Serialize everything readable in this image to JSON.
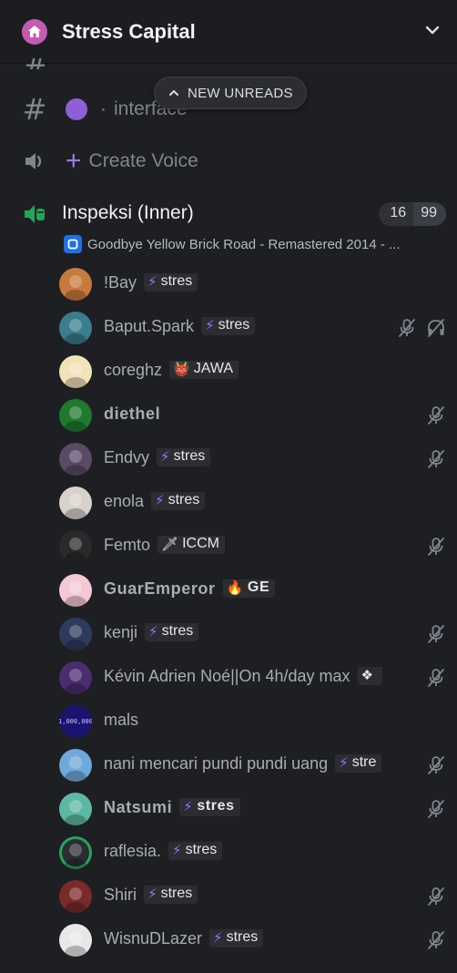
{
  "server": {
    "name": "Stress Capital",
    "icon": "home-icon",
    "accent": "#c45bb1"
  },
  "unreads_pill": {
    "label": "NEW UNREADS",
    "icon": "chevron-up-icon"
  },
  "channels": [
    {
      "type": "text",
      "icon": "hash-icon",
      "prefix_icon": "purple-circle",
      "separator": "·",
      "name": "interface"
    },
    {
      "type": "voice",
      "icon": "speaker-icon",
      "prefix_icon": "plus-icon",
      "name": "Create Voice"
    }
  ],
  "voice_channel": {
    "name": "Inspeksi (Inner)",
    "icon": "voice-connected-icon",
    "count_current": "16",
    "count_limit": "99",
    "activity": "Goodbye Yellow Brick Road - Remastered 2014 - ..."
  },
  "members": [
    {
      "name": "!Bay",
      "tag_glyph": "⚡",
      "tag": "stres",
      "bold": false,
      "muted": false,
      "deafened": false,
      "avatar_bg": "#c77a3d"
    },
    {
      "name": "Baput.Spark",
      "tag_glyph": "⚡",
      "tag": "stres",
      "bold": false,
      "muted": true,
      "deafened": true,
      "avatar_bg": "#3a7d8c"
    },
    {
      "name": "coreghz",
      "tag_glyph": "👹",
      "tag": "JAWA",
      "bold": false,
      "muted": false,
      "deafened": false,
      "avatar_bg": "#f2e2b8"
    },
    {
      "name": "diethel",
      "tag_glyph": "",
      "tag": "",
      "bold": true,
      "muted": true,
      "deafened": false,
      "avatar_bg": "#1f7a2e"
    },
    {
      "name": "Endvy",
      "tag_glyph": "⚡",
      "tag": "stres",
      "bold": false,
      "muted": true,
      "deafened": false,
      "avatar_bg": "#5a4a66"
    },
    {
      "name": "enola",
      "tag_glyph": "⚡",
      "tag": "stres",
      "bold": false,
      "muted": false,
      "deafened": false,
      "avatar_bg": "#d8d2cc"
    },
    {
      "name": "Femto",
      "tag_glyph": "🗡",
      "tag": "ICCM",
      "bold": false,
      "muted": true,
      "deafened": false,
      "avatar_bg": "#2a2a2a"
    },
    {
      "name": "GuarEmperor",
      "tag_glyph": "🔥",
      "tag": "GE",
      "bold": true,
      "muted": false,
      "deafened": false,
      "avatar_bg": "#f4c9d6"
    },
    {
      "name": "kenji",
      "tag_glyph": "⚡",
      "tag": "stres",
      "bold": false,
      "muted": true,
      "deafened": false,
      "avatar_bg": "#2c3a5c"
    },
    {
      "name": "Kévin Adrien Noé||On 4h/day max",
      "tag_glyph": "❖",
      "tag": "",
      "bold": false,
      "muted": true,
      "deafened": false,
      "avatar_bg": "#4a2d6e"
    },
    {
      "name": "mals",
      "tag_glyph": "",
      "tag": "",
      "bold": false,
      "muted": false,
      "deafened": false,
      "avatar_bg": "#1a1470",
      "avatar_text": "1,000,000"
    },
    {
      "name": "nani mencari pundi pundi uang",
      "tag_glyph": "⚡",
      "tag": "stre",
      "bold": false,
      "muted": true,
      "deafened": false,
      "avatar_bg": "#6fa8d9"
    },
    {
      "name": "Natsumi",
      "tag_glyph": "⚡",
      "tag": "stres",
      "bold": true,
      "muted": true,
      "deafened": false,
      "avatar_bg": "#5cb8a5"
    },
    {
      "name": "raflesia.",
      "tag_glyph": "⚡",
      "tag": "stres",
      "bold": false,
      "muted": false,
      "deafened": false,
      "avatar_bg": "#2b2d31",
      "speaking": true
    },
    {
      "name": "Shiri",
      "tag_glyph": "⚡",
      "tag": "stres",
      "bold": false,
      "muted": true,
      "deafened": false,
      "avatar_bg": "#7a2a2a"
    },
    {
      "name": "WisnuDLazer",
      "tag_glyph": "⚡",
      "tag": "stres",
      "bold": false,
      "muted": true,
      "deafened": false,
      "avatar_bg": "#e8e8e8"
    }
  ],
  "colors": {
    "background": "#1e1f22",
    "channel_text": "#80848e",
    "member_text": "#a8acb3",
    "voice_green": "#23a55a",
    "lightning": "#a46cff"
  }
}
